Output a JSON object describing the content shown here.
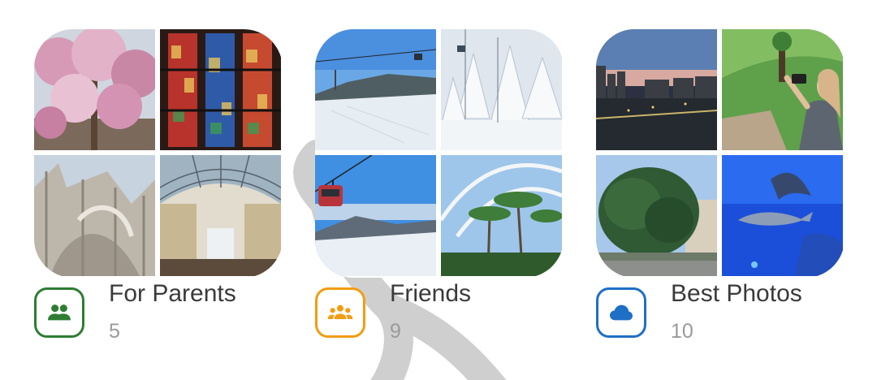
{
  "albums": [
    {
      "title": "For Parents",
      "count": "5",
      "icon": "people-icon",
      "accent": "#2e7d32",
      "photos": [
        "magnolia-blossom",
        "stained-glass-window",
        "cathedral-facade",
        "glass-dome-gallery"
      ]
    },
    {
      "title": "Friends",
      "count": "9",
      "icon": "group-icon",
      "accent": "#f39c12",
      "photos": [
        "ski-slope-gondola",
        "snowy-trees",
        "cable-car-mountains",
        "palm-trees-arches"
      ]
    },
    {
      "title": "Best Photos",
      "count": "10",
      "icon": "cloud-icon",
      "accent": "#1e6fc6",
      "photos": [
        "city-dusk",
        "woman-taking-photo",
        "large-tree",
        "aquarium-manta-ray"
      ]
    }
  ]
}
